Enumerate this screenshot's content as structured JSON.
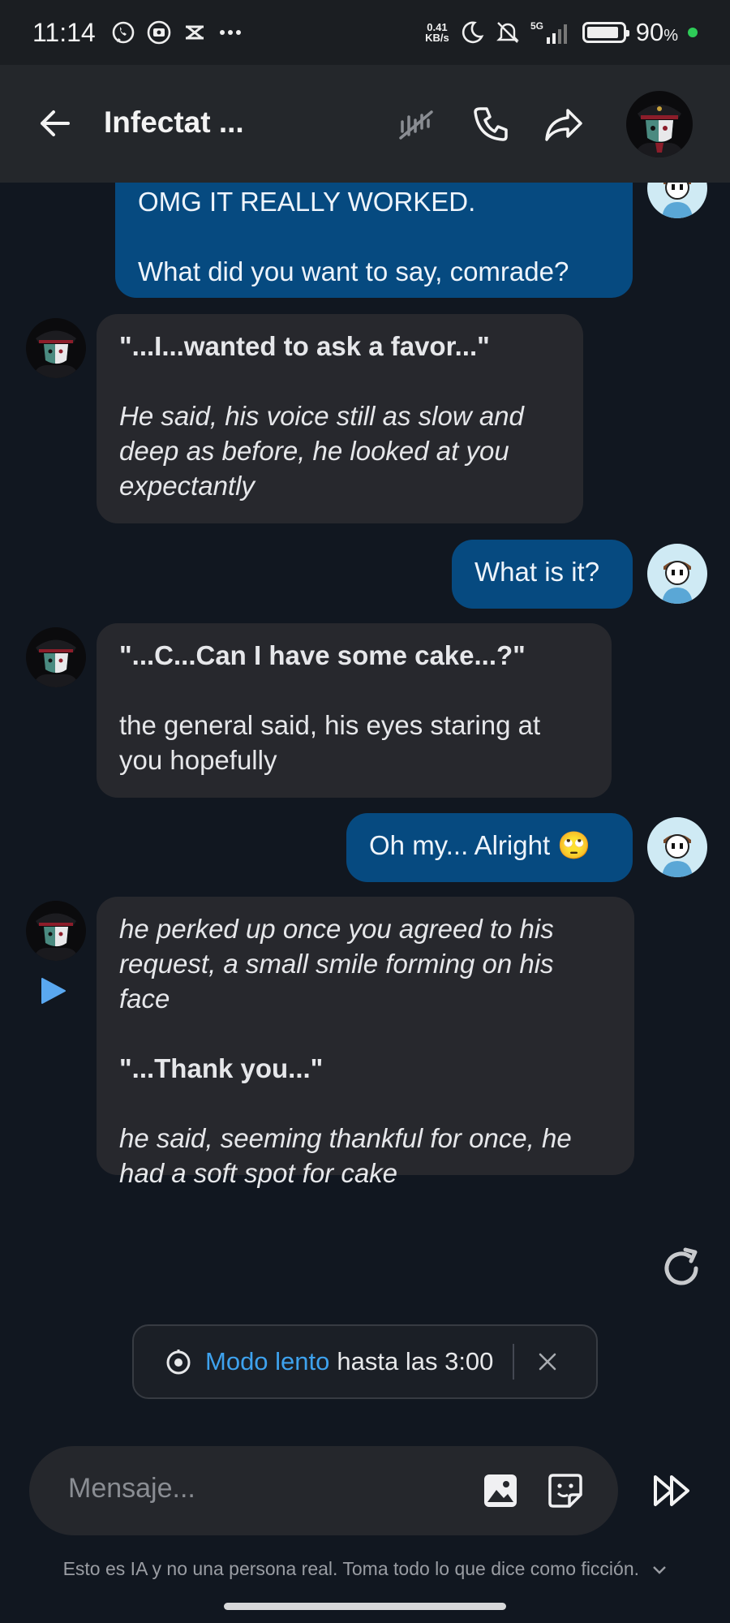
{
  "status_bar": {
    "time": "11:14",
    "net_speed_value": "0.41",
    "net_speed_unit": "KB/s",
    "network": "5G",
    "battery": "90",
    "battery_unit": "%"
  },
  "header": {
    "title": "Infectat ...",
    "icons": [
      "back-arrow-icon",
      "mute-voice-icon",
      "phone-icon",
      "share-icon",
      "character-avatar"
    ]
  },
  "messages": [
    {
      "sender": "user",
      "parts": [
        {
          "style": "normal",
          "text": "OMG IT REALLY WORKED."
        },
        {
          "style": "normal",
          "text": "What did you want to say, comrade?"
        }
      ]
    },
    {
      "sender": "ai",
      "parts": [
        {
          "style": "bold",
          "text": "\"...I...wanted to ask a favor...\""
        },
        {
          "style": "italic",
          "text": "He said, his voice still as slow and deep as before, he looked at you expectantly"
        }
      ]
    },
    {
      "sender": "user",
      "parts": [
        {
          "style": "normal",
          "text": "What is it?"
        }
      ]
    },
    {
      "sender": "ai",
      "parts": [
        {
          "style": "bold",
          "text": "\"...C...Can I have some cake...?\""
        },
        {
          "style": "normal",
          "text": "the general said, his eyes staring at you hopefully"
        }
      ]
    },
    {
      "sender": "user",
      "parts": [
        {
          "style": "normal",
          "text": "Oh my... Alright 🙄"
        }
      ]
    },
    {
      "sender": "ai",
      "parts": [
        {
          "style": "italic",
          "text": "he perked up once you agreed to his request, a small smile forming on his face"
        },
        {
          "style": "bold",
          "text": "\"...Thank you...\""
        },
        {
          "style": "italic",
          "text": "he said, seeming thankful for once, he had a soft spot for cake"
        }
      ]
    }
  ],
  "slow_mode": {
    "accent_text": "Modo lento",
    "rest_text": "hasta las 3:00"
  },
  "composer": {
    "placeholder": "Mensaje..."
  },
  "disclaimer": "Esto es IA y no una persona real. Toma todo lo que dice como ficción.",
  "colors": {
    "background": "#111720",
    "user_bubble": "#064a80",
    "ai_bubble": "#27282d",
    "accent": "#3ea2ee"
  }
}
